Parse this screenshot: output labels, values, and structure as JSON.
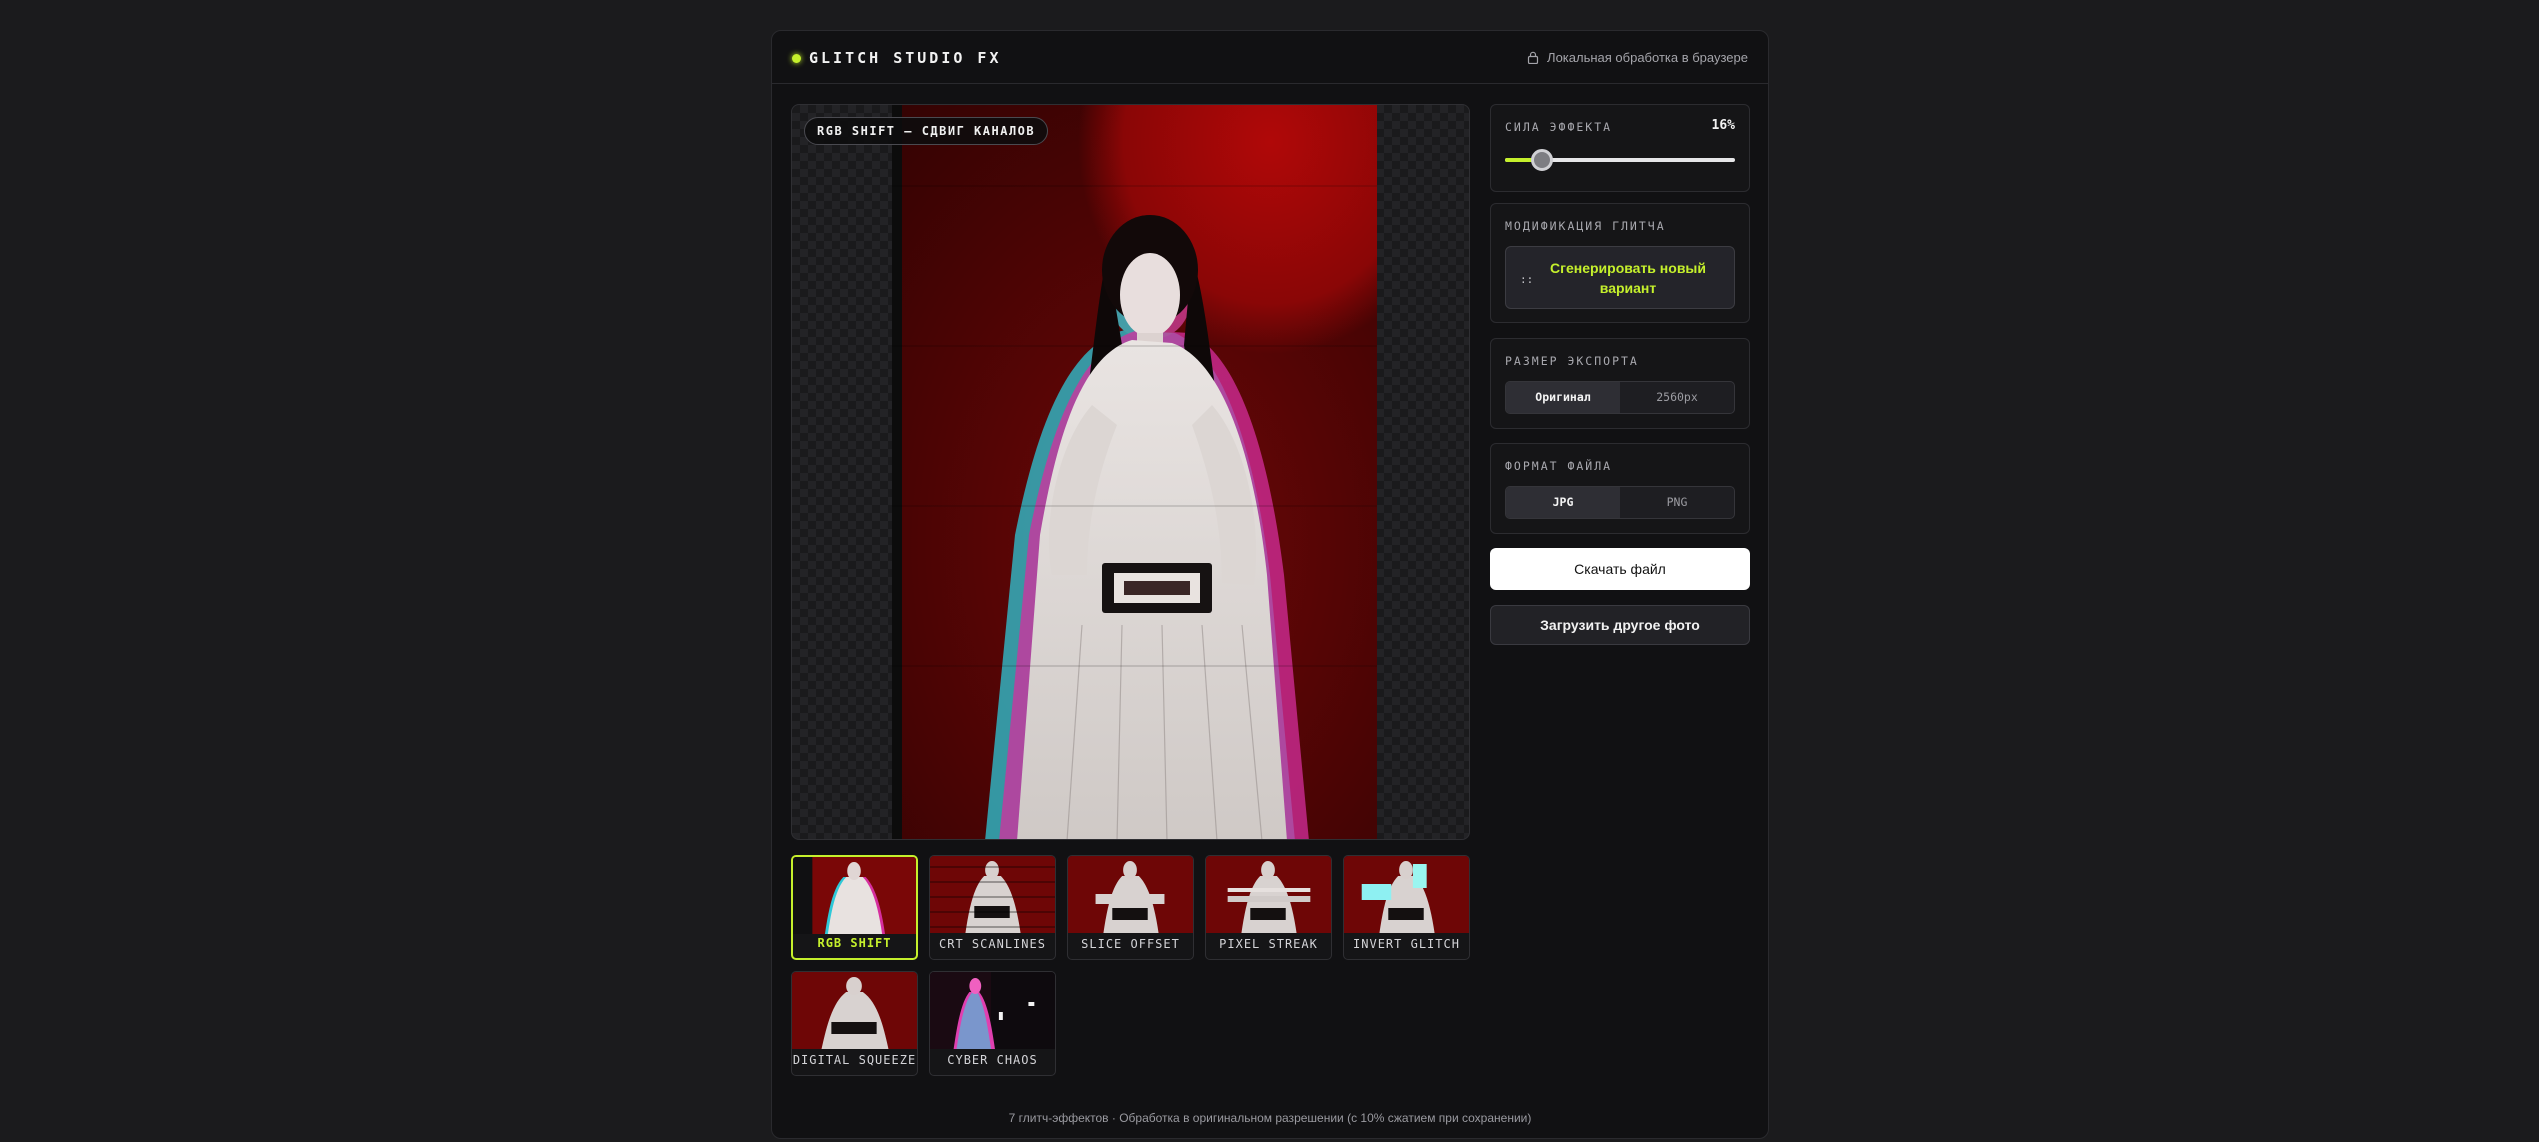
{
  "header": {
    "title": "GLITCH STUDIO FX",
    "local_note": "Локальная обработка в браузере"
  },
  "preview": {
    "badge": "RGB SHIFT — СДВИГ КАНАЛОВ"
  },
  "effects": [
    {
      "label": "RGB SHIFT",
      "active": true
    },
    {
      "label": "CRT SCANLINES",
      "active": false
    },
    {
      "label": "SLICE OFFSET",
      "active": false
    },
    {
      "label": "PIXEL STREAK",
      "active": false
    },
    {
      "label": "INVERT GLITCH",
      "active": false
    },
    {
      "label": "DIGITAL SQUEEZE",
      "active": false
    },
    {
      "label": "CYBER CHAOS",
      "active": false
    }
  ],
  "strength": {
    "title": "СИЛА ЭФФЕКТА",
    "value_label": "16%",
    "value": 16
  },
  "modify": {
    "title": "МОДИФИКАЦИЯ ГЛИТЧА",
    "icon": "::",
    "button": "Сгенерировать новый вариант"
  },
  "export_size": {
    "title": "РАЗМЕР ЭКСПОРТА",
    "options": [
      "Оригинал",
      "2560px"
    ],
    "selected": "Оригинал"
  },
  "file_format": {
    "title": "ФОРМАТ ФАЙЛА",
    "options": [
      "JPG",
      "PNG"
    ],
    "selected": "JPG"
  },
  "actions": {
    "download": "Скачать файл",
    "upload": "Загрузить другое фото"
  },
  "footer": "7 глитч-эффектов · Обработка в оригинальном разрешении (с 10% сжатием при сохранении)",
  "colors": {
    "accent": "#c5f02c",
    "background": "#1b1b1d",
    "panel": "#111113"
  }
}
